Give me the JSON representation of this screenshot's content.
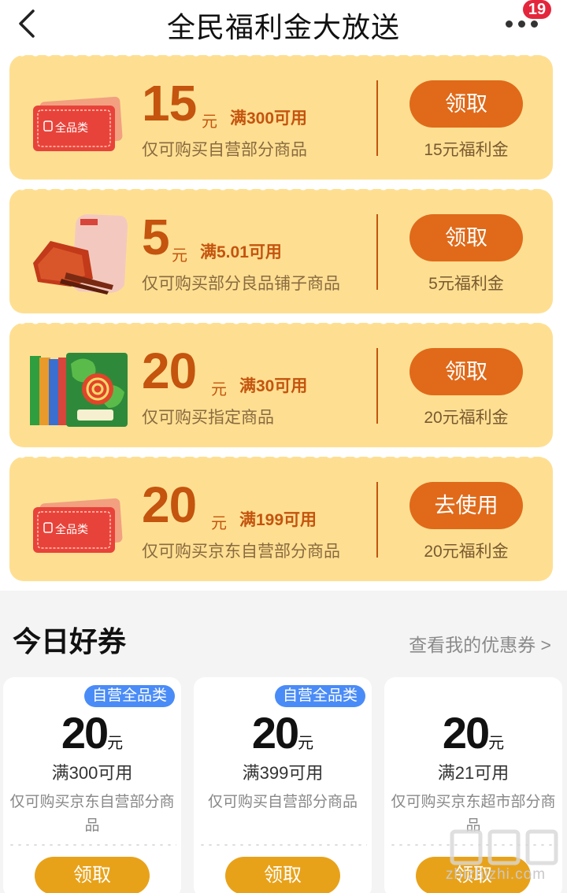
{
  "header": {
    "title": "全民福利金大放送",
    "badge_count": "19"
  },
  "coupons": [
    {
      "amount": "15",
      "unit": "元",
      "condition": "满300可用",
      "description": "仅可购买自营部分商品",
      "button": "领取",
      "sub": "15元福利金",
      "thumb_label": "全品类"
    },
    {
      "amount": "5",
      "unit": "元",
      "condition": "满5.01可用",
      "description": "仅可购买部分良品铺子商品",
      "button": "领取",
      "sub": "5元福利金"
    },
    {
      "amount": "20",
      "unit": "元",
      "condition": "满30可用",
      "description": "仅可购买指定商品",
      "button": "领取",
      "sub": "20元福利金"
    },
    {
      "amount": "20",
      "unit": "元",
      "condition": "满199可用",
      "description": "仅可购买京东自营部分商品",
      "button": "去使用",
      "sub": "20元福利金",
      "thumb_label": "全品类"
    }
  ],
  "today": {
    "title": "今日好券",
    "link": "查看我的优惠券 >",
    "items": [
      {
        "tag": "自营全品类",
        "amount": "20",
        "unit": "元",
        "condition": "满300可用",
        "description": "仅可购买京东自营部分商品",
        "button": "领取"
      },
      {
        "tag": "自营全品类",
        "amount": "20",
        "unit": "元",
        "condition": "满399可用",
        "description": "仅可购买自营部分商品",
        "button": "领取"
      },
      {
        "amount": "20",
        "unit": "元",
        "condition": "满21可用",
        "description": "仅可购买京东超市部分商品",
        "button": "领取"
      }
    ]
  },
  "watermark": "zhizhizhi.com",
  "colors": {
    "card_bg": "#fedf92",
    "accent": "#c4540e",
    "button": "#e06a1a",
    "tag_blue": "#4a8cf7",
    "mini_button": "#e8a21a"
  }
}
